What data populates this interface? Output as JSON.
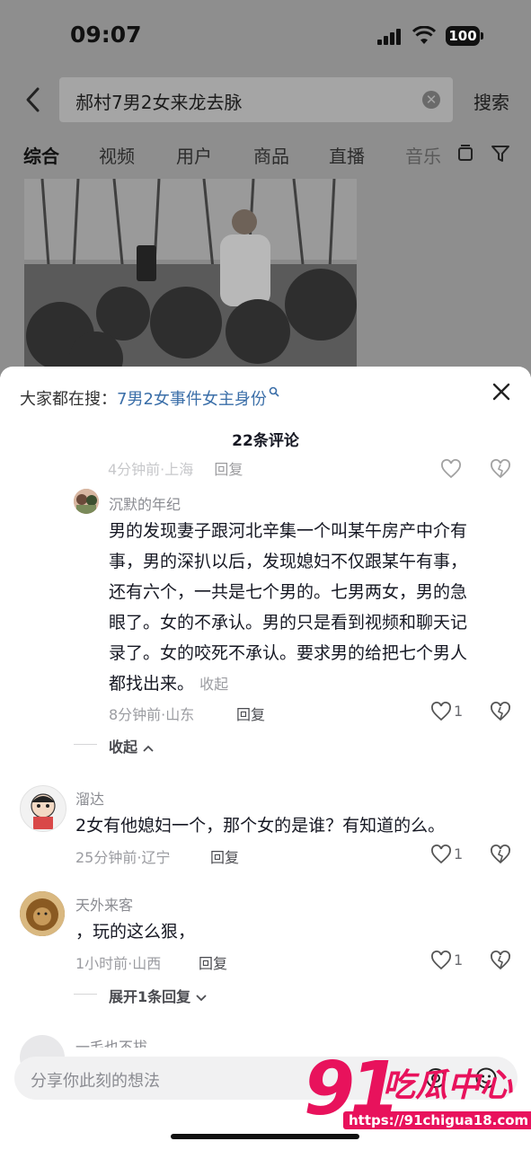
{
  "status_bar": {
    "time": "09:07",
    "battery": "100"
  },
  "search": {
    "query": "郝村7男2女来龙去脉",
    "button": "搜索"
  },
  "tabs": [
    {
      "label": "综合",
      "active": true
    },
    {
      "label": "视频"
    },
    {
      "label": "用户"
    },
    {
      "label": "商品"
    },
    {
      "label": "直播"
    },
    {
      "label": "音乐"
    }
  ],
  "sheet": {
    "hot_prefix": "大家都在搜：",
    "hot_query": "7男2女事件女主身份",
    "comment_count": "22条评论",
    "partial_meta": "4分钟前·上海",
    "partial_reply": "回复"
  },
  "comments": [
    {
      "name": "沉默的年纪",
      "lines": [
        "男的发现妻子跟河北辛集一个叫某午房产中介有",
        "事，男的深扒以后，发现媳妇不仅跟某午有事，",
        "还有六个，一共是七个男的。七男两女，男的急",
        "眼了。女的不承认。男的只是看到视频和聊天记",
        "录了。女的咬死不承认。要求男的给把七个男人",
        "都找出来。"
      ],
      "fold_label": "收起",
      "meta": "8分钟前·山东",
      "reply": "回复",
      "likes": "1",
      "collapse_label": "收起"
    },
    {
      "name": "溜达",
      "text": "2女有他媳妇一个，那个女的是谁？有知道的么。",
      "meta": "25分钟前·辽宁",
      "reply": "回复",
      "likes": "1"
    },
    {
      "name": "天外来客",
      "text": "，玩的这么狠，",
      "meta": "1小时前·山西",
      "reply": "回复",
      "likes": "1",
      "expand_label": "展开1条回复"
    },
    {
      "name": "一毛也不拔"
    }
  ],
  "input": {
    "placeholder": "分享你此刻的想法"
  },
  "watermark": {
    "logo": "91",
    "logo_text": "吃瓜中心",
    "url": "https://91chigua18.com"
  },
  "colors": {
    "accent_link": "#3a6ea8",
    "watermark": "#e8125c"
  }
}
